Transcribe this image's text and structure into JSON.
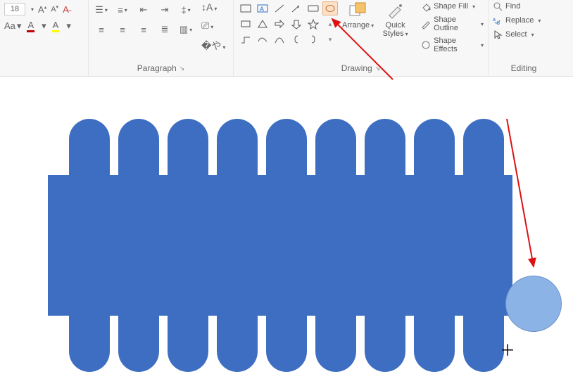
{
  "font": {
    "size": "18"
  },
  "groups": {
    "paragraph": "Paragraph",
    "drawing": "Drawing",
    "editing": "Editing"
  },
  "drawing": {
    "arrange": "Arrange",
    "quick_styles_l1": "Quick",
    "quick_styles_l2": "Styles",
    "shape_fill": "Shape Fill",
    "shape_outline": "Shape Outline",
    "shape_effects": "Shape Effects"
  },
  "editing_cmds": {
    "find": "Find",
    "replace": "Replace",
    "select": "Select"
  },
  "chart_data": {
    "type": "other",
    "note": "PowerPoint slide canvas with a custom blue rounded-lobe shape and an oval being drawn at the right edge"
  }
}
